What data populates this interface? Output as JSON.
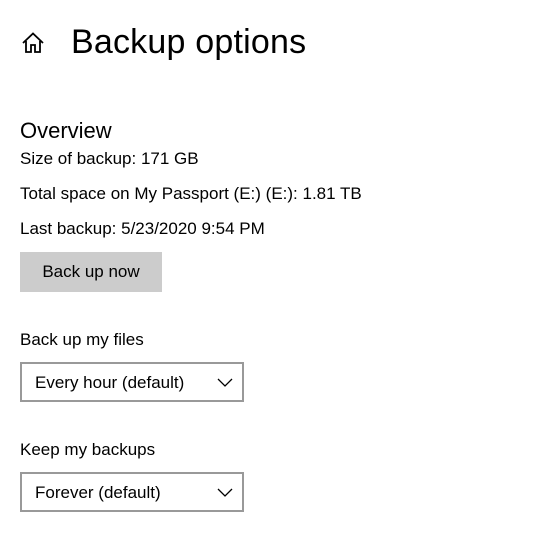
{
  "header": {
    "title": "Backup options",
    "home_icon": "home-icon"
  },
  "overview": {
    "title": "Overview",
    "size_line": "Size of backup: 171 GB",
    "space_line": "Total space on My Passport (E:) (E:): 1.81 TB",
    "last_backup_line": "Last backup: 5/23/2020 9:54 PM",
    "back_up_now_label": "Back up now"
  },
  "frequency": {
    "label": "Back up my files",
    "selected": "Every hour (default)",
    "icon": "chevron-down-icon"
  },
  "retention": {
    "label": "Keep my backups",
    "selected": "Forever (default)",
    "icon": "chevron-down-icon"
  },
  "colors": {
    "background": "#ffffff",
    "text": "#000000",
    "button_bg": "#cccccc",
    "dropdown_border": "#999999"
  }
}
